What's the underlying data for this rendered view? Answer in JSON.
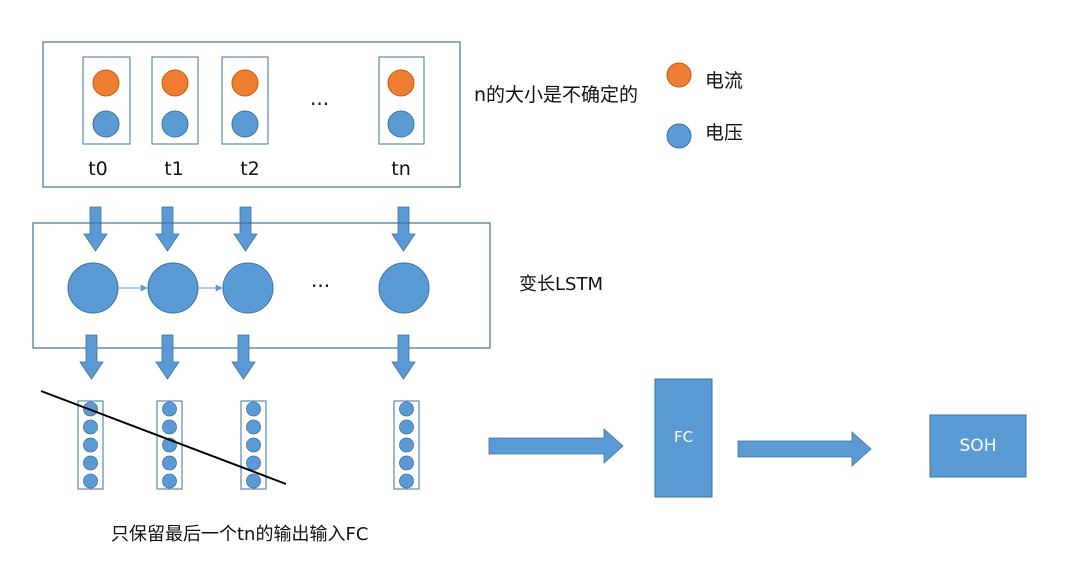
{
  "top_block": {
    "time_labels": [
      "t0",
      "t1",
      "t2",
      "tn"
    ],
    "ellipsis": "..."
  },
  "top_note": "n的大小是不确定的",
  "legend": [
    {
      "label": "电流",
      "color": "#ED7D31"
    },
    {
      "label": "电压",
      "color": "#5B9BD5"
    }
  ],
  "lstm_block": {
    "label": "变长LSTM",
    "ellipsis": "..."
  },
  "fc_box": {
    "label": "FC"
  },
  "soh_box": {
    "label": "SOH"
  },
  "bottom_note": "只保留最后一个tn的输出输入FC",
  "colors": {
    "node_blue": "#5B9BD5",
    "node_orange": "#ED7D31",
    "border_blue": "#41719C",
    "arrow_blue": "#5B9BD5"
  }
}
